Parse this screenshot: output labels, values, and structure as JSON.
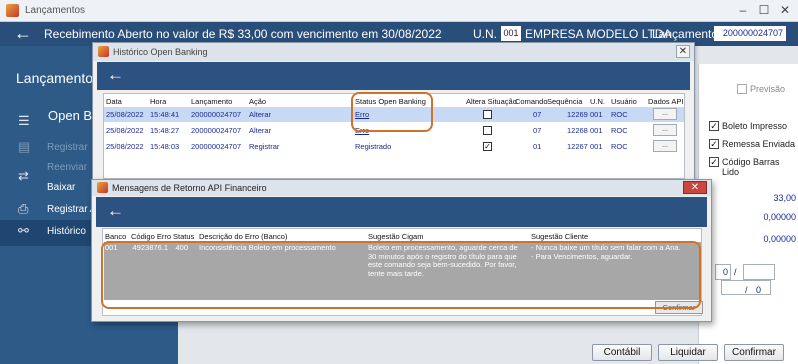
{
  "main": {
    "title": "Lançamentos",
    "header_message": "Recebimento Aberto no valor de R$ 33,00 com vencimento em 30/08/2022",
    "un_label": "U.N.",
    "un_value": "001",
    "empresa": "EMPRESA MODELO LTDA",
    "lancamento_label": "Lançamento",
    "lancamento_value": "200000024707",
    "window_buttons": {
      "minimize": "–",
      "maximize": "☐",
      "close": "✕"
    }
  },
  "sidebar": {
    "title": "Lançamentos",
    "subtitle": "Open Ba",
    "items": [
      {
        "label": "Registrar",
        "icon": "document-icon",
        "glyph": "▤",
        "disabled": true
      },
      {
        "label": "Reenviar",
        "icon": "resend-icon",
        "glyph": "",
        "disabled": true
      },
      {
        "label": "Baixar",
        "icon": "swap-icon",
        "glyph": "⇄",
        "disabled": false
      },
      {
        "label": "Registrar Al",
        "icon": "printer-icon",
        "glyph": "⎙",
        "disabled": false
      },
      {
        "label": "Histórico",
        "icon": "tree-icon",
        "glyph": "⚯",
        "disabled": false
      }
    ]
  },
  "right_panel": {
    "previsao_label": "Previsão",
    "boleto_impresso": "Boleto Impresso",
    "remessa_enviada": "Remessa Enviada",
    "codigo_barras_lido": "Código Barras Lido",
    "valor1": "33,00",
    "valor2": "0,00000",
    "valor3": "0,00000",
    "field_zero": "0",
    "slash1": "/",
    "slash2": "/",
    "field_zero2": "0"
  },
  "bottom_buttons": {
    "contabil": "Contábil",
    "liquidar": "Liquidar",
    "confirmar": "Confirmar"
  },
  "historico": {
    "title": "Histórico Open Banking",
    "columns": [
      "Data",
      "Hora",
      "Lançamento",
      "Ação",
      "Status Open Banking",
      "Altera Situação",
      "Comando",
      "Sequência",
      "U.N.",
      "Usuário",
      "Dados API"
    ],
    "rows": [
      {
        "data": "25/08/2022",
        "hora": "15:48:41",
        "lancamento": "200000024707",
        "acao": "Alterar",
        "status": "Erro",
        "altera": false,
        "comando": "07",
        "sequencia": "12269",
        "un": "001",
        "usuario": "ROC",
        "dados": "..."
      },
      {
        "data": "25/08/2022",
        "hora": "15:48:27",
        "lancamento": "200000024707",
        "acao": "Alterar",
        "status": "Erro",
        "altera": false,
        "comando": "07",
        "sequencia": "12268",
        "un": "001",
        "usuario": "ROC",
        "dados": "..."
      },
      {
        "data": "25/08/2022",
        "hora": "15:48:03",
        "lancamento": "200000024707",
        "acao": "Registrar",
        "status": "Registrado",
        "altera": true,
        "comando": "01",
        "sequencia": "12267",
        "un": "001",
        "usuario": "ROC",
        "dados": "..."
      }
    ]
  },
  "mensagens": {
    "title": "Mensagens de Retorno API Financeiro",
    "columns": [
      "Banco",
      "Código Erro",
      "Status",
      "Descrição do Erro (Banco)",
      "Sugestão Cigam",
      "Sugestão Cliente"
    ],
    "row": {
      "banco": "001",
      "codigo": "4923876.1",
      "status": "400",
      "descricao": "Inconsistência Boleto em processamento",
      "sugestao_cigam": "Boleto em processamento, aguarde cerca de 30 minutos após o registro do título para que este comando seja bem-sucedido. Por favor, tente mais tarde.",
      "sugestao_cliente_1": "- Nunca baixe um título sem falar com a Ana.",
      "sugestao_cliente_2": "- Para Vencimentos, aguardar."
    },
    "confirm_button": "Confirmar",
    "close_glyph": "✕"
  }
}
